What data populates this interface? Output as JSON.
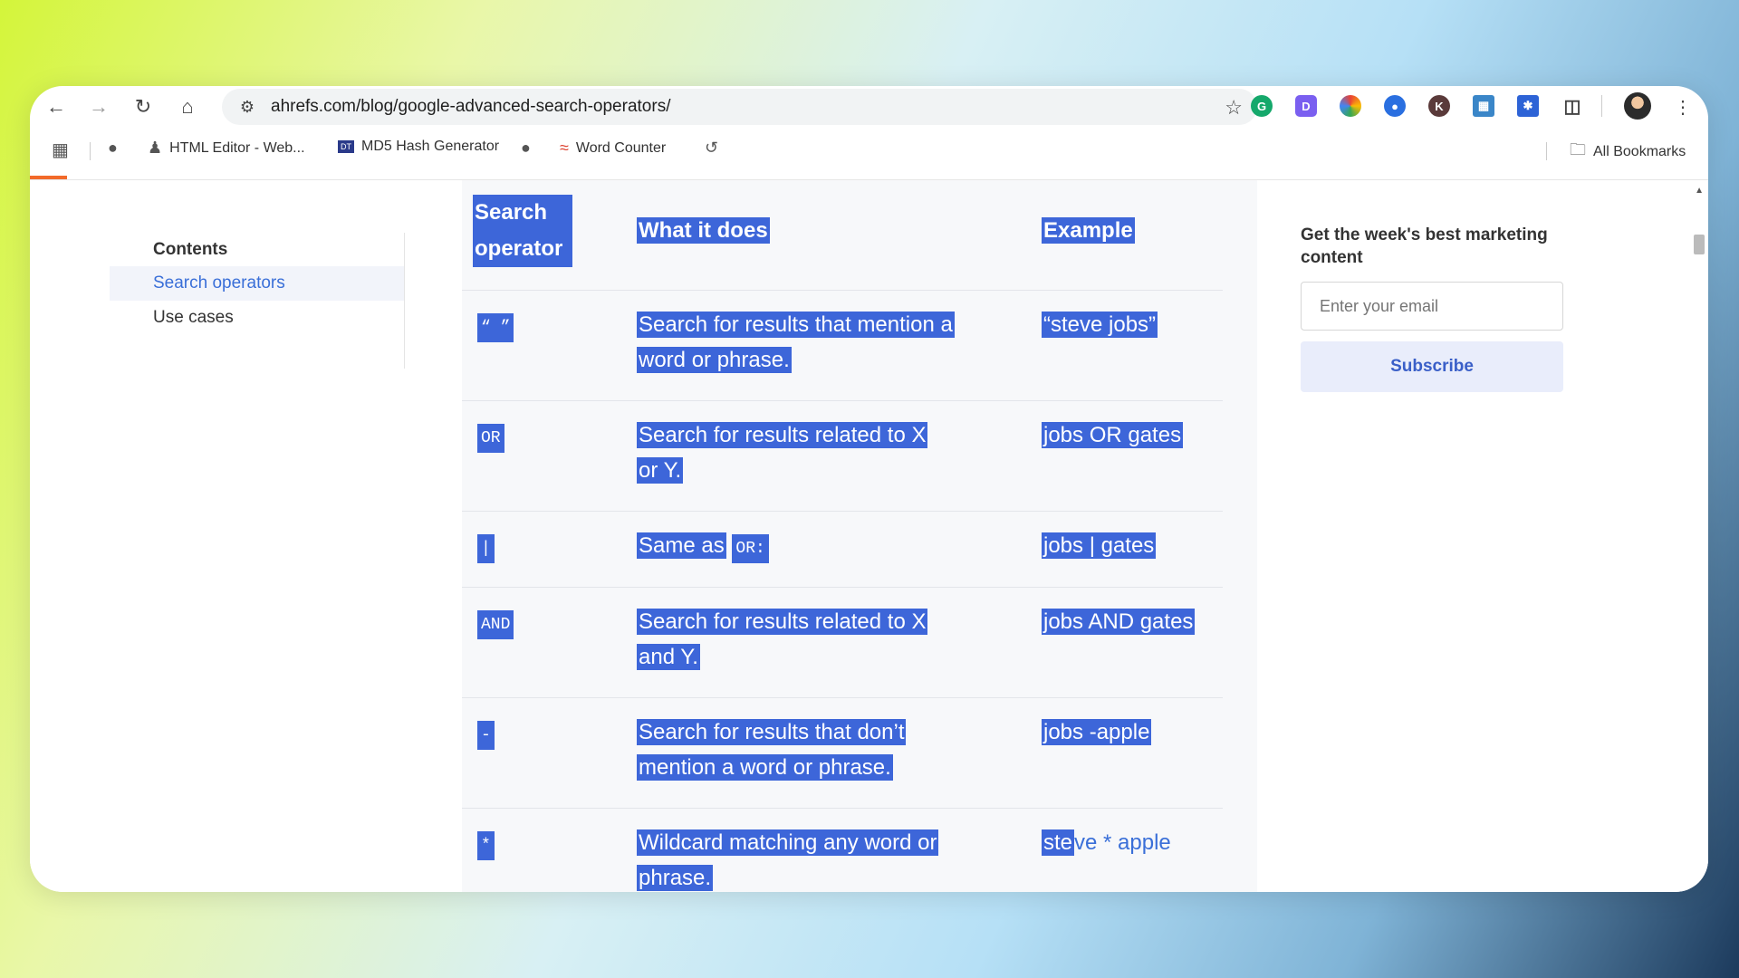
{
  "browser": {
    "url": "ahrefs.com/blog/google-advanced-search-operators/",
    "bookmarks": [
      {
        "label": "HTML Editor - Web...",
        "icon": "person-icon"
      },
      {
        "label": "MD5 Hash Generator",
        "icon": "dans-tools-icon"
      },
      {
        "label": "Word Counter",
        "icon": "word-counter-icon"
      }
    ],
    "all_bookmarks": "All Bookmarks",
    "progress_fraction": 0.022
  },
  "toc": {
    "title": "Contents",
    "items": [
      "Search operators",
      "Use cases"
    ],
    "active_index": 0
  },
  "table": {
    "headers": [
      "Search operator",
      "What it does",
      "Example"
    ],
    "rows": [
      {
        "op": "“ ”",
        "desc": "Search for results that mention a word or phrase.",
        "example": "“steve jobs”"
      },
      {
        "op": "OR",
        "desc": "Search for results related to X or Y.",
        "example": "jobs OR gates"
      },
      {
        "op": "|",
        "desc_prefix": "Same as",
        "desc_code": "OR:",
        "example": "jobs | gates"
      },
      {
        "op": "AND",
        "desc": "Search for results related to X and Y.",
        "example": "jobs AND gates"
      },
      {
        "op": "-",
        "desc": "Search for results that don’t mention a word or phrase.",
        "example": "jobs -apple"
      },
      {
        "op": "*",
        "desc": "Wildcard matching any word or phrase.",
        "example_selected": "ste",
        "example_rest": "ve * apple"
      }
    ]
  },
  "newsletter": {
    "title": "Get the week's best marketing content",
    "email_placeholder": "Enter your email",
    "subscribe_label": "Subscribe"
  }
}
